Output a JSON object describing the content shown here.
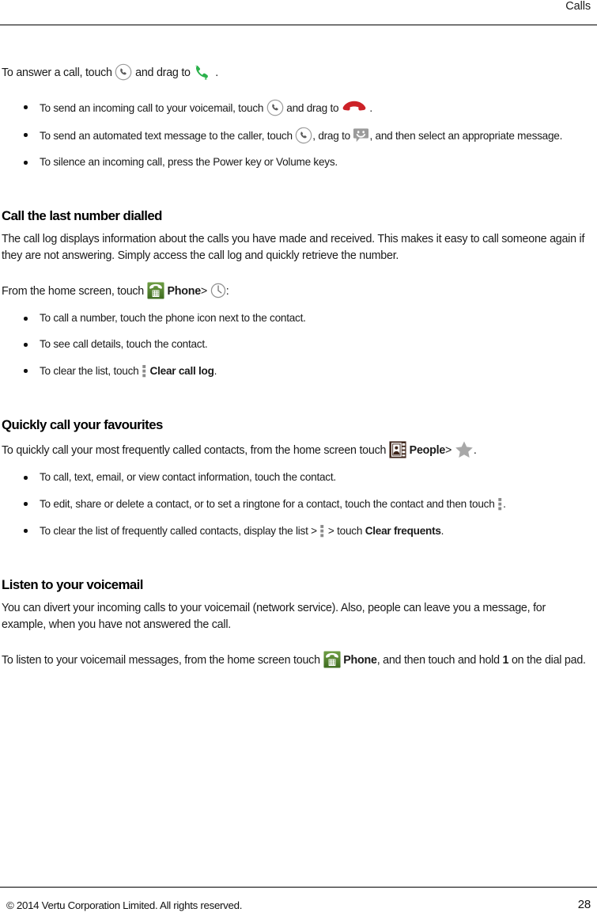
{
  "header": {
    "title": "Calls"
  },
  "intro": {
    "lead_before_icon": "To answer a call, touch",
    "lead_mid": "and drag to",
    "lead_end": ".",
    "bullets": [
      {
        "part1": "To send an incoming call to your voicemail, touch",
        "part2": "and drag to",
        "part3": "."
      },
      {
        "part1": "To send an automated text message to the caller, touch",
        "part2": ", drag to",
        "part3": ", and then select an appropriate message."
      },
      {
        "part1": "To silence an incoming call, press the Power key or Volume keys."
      }
    ]
  },
  "sections": [
    {
      "heading": "Call the last number dialled",
      "paragraph": "The call log displays information about the calls you have made and received. This makes it easy to call someone again if they are not answering. Simply access the call log and quickly retrieve the number.",
      "lead_before": "From the home screen, touch",
      "app_label": "Phone",
      "lead_sep": ">",
      "lead_end": ":",
      "bullets": [
        {
          "part1": "To call a number, touch the phone icon next to the contact."
        },
        {
          "part1": "To see call details, touch the contact."
        },
        {
          "part1": "To clear the list, touch",
          "bold_label": "Clear call log",
          "part3": "."
        }
      ]
    },
    {
      "heading": "Quickly call your favourites",
      "lead_before": "To quickly call your most frequently called contacts, from the home screen touch",
      "app_label": "People",
      "lead_sep": ">",
      "lead_end": ".",
      "bullets": [
        {
          "part1": "To call, text, email, or view contact information, touch the contact."
        },
        {
          "part1": "To edit, share or delete a contact, or to set a ringtone for a contact, touch the contact and then touch",
          "part3": "."
        },
        {
          "part1": "To clear the list of frequently called contacts, display the list >",
          "part2": "> touch",
          "bold_label": "Clear frequents",
          "part3": "."
        }
      ]
    },
    {
      "heading": "Listen to your voicemail",
      "paragraph": "You can divert your incoming calls to your voicemail (network service). Also, people can leave you a message, for example, when you have not answered the call.",
      "closing": {
        "part1": "To listen to your voicemail messages, from the home screen touch",
        "app_label": "Phone",
        "part2": ", and then touch and hold",
        "key": "1",
        "part3": "on the dial pad."
      }
    }
  ],
  "footer": {
    "copyright": "© 2014 Vertu Corporation Limited. All rights reserved.",
    "page_number": "28"
  },
  "colors": {
    "answer_green": "#2bb14b",
    "decline_red": "#cc2127",
    "phone_app_green": "#4a7c27",
    "people_app_brown": "#3c2318",
    "icon_grey": "#8c8c8c",
    "star_grey": "#a3a3a3",
    "rule_black": "#000000"
  }
}
